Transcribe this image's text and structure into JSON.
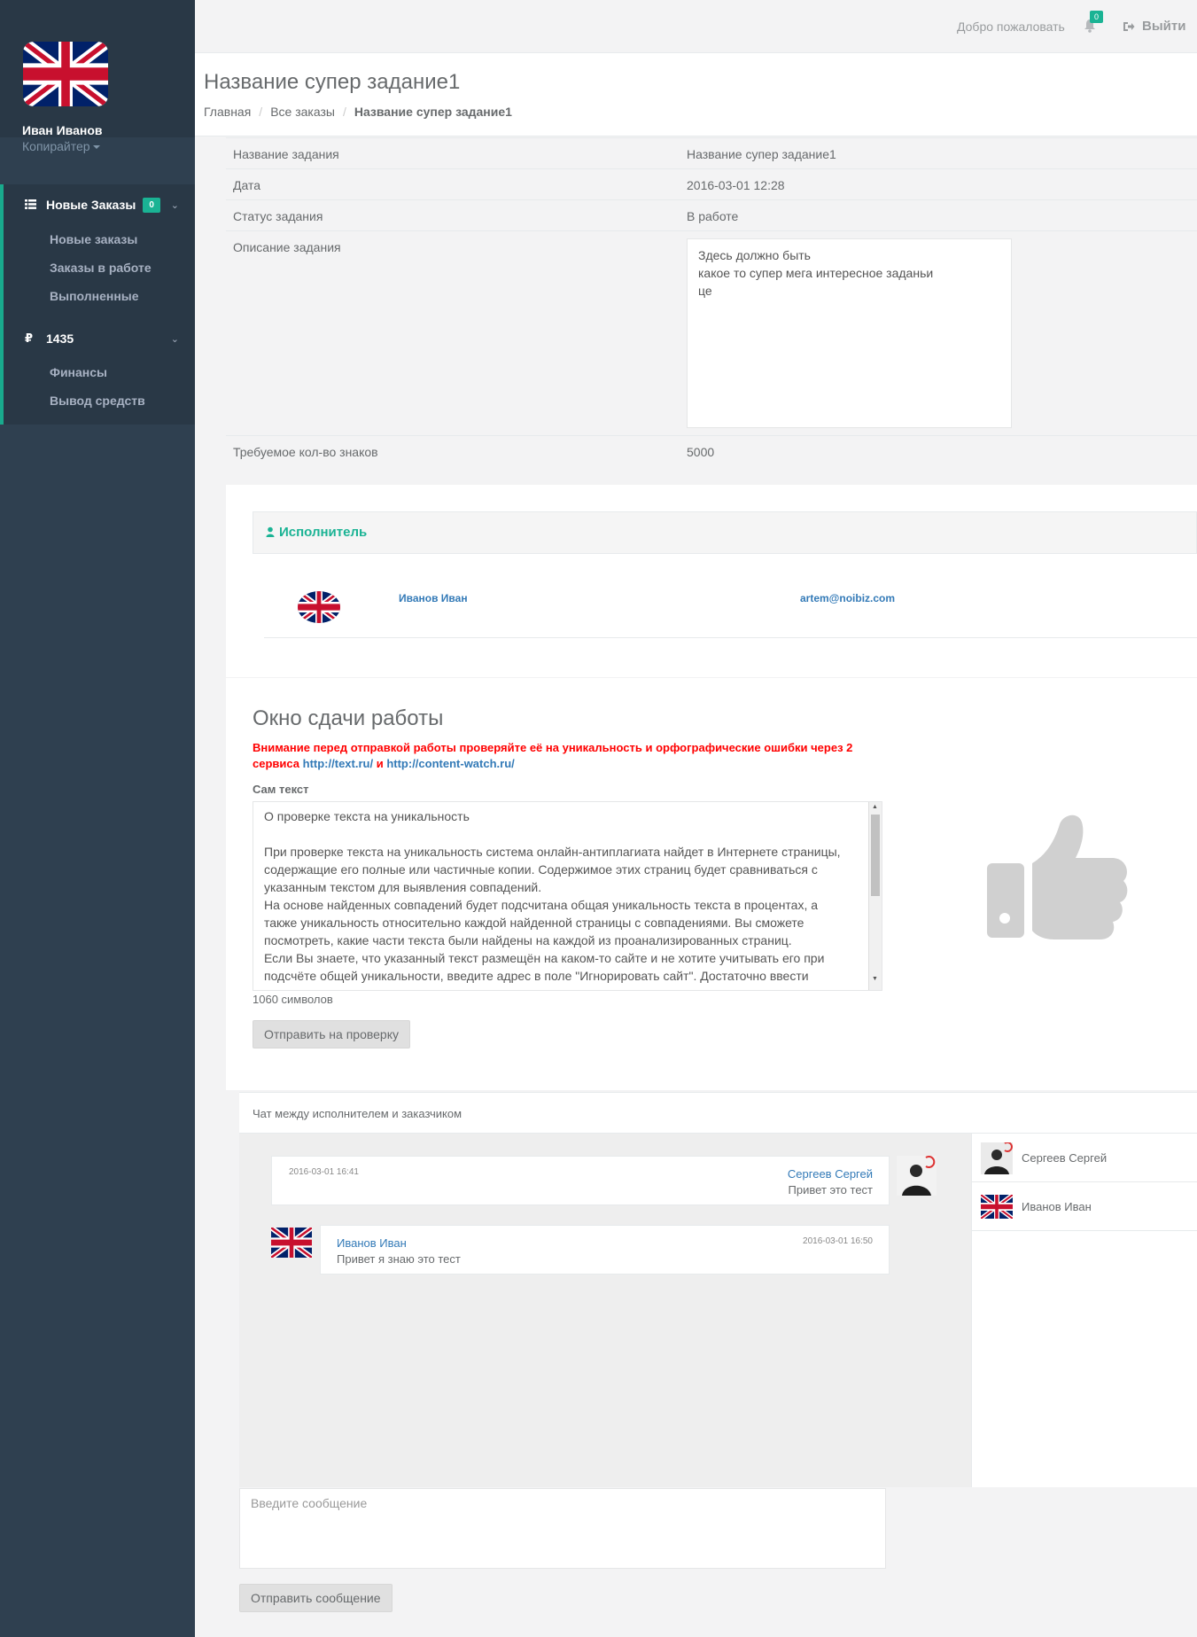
{
  "sidebar": {
    "user_name": "Иван Иванов",
    "user_role": "Копирайтер",
    "group1": {
      "label": "Новые Заказы",
      "badge": "0",
      "items": [
        "Новые заказы",
        "Заказы в работе",
        "Выполненные"
      ]
    },
    "group2": {
      "label": "1435",
      "icon": "₽",
      "items": [
        "Финансы",
        "Вывод средств"
      ]
    }
  },
  "topbar": {
    "welcome": "Добро пожаловать",
    "notifications": "0",
    "logout": "Выйти"
  },
  "page": {
    "title": "Название супер задание1",
    "breadcrumb": [
      "Главная",
      "Все заказы",
      "Название супер задание1"
    ]
  },
  "details": [
    {
      "key": "Название задания",
      "value": "Название супер задание1"
    },
    {
      "key": "Дата",
      "value": "2016-03-01 12:28"
    },
    {
      "key": "Статус задания",
      "value": "В работе"
    },
    {
      "key": "Описание задания",
      "value": "Здесь должно быть\nкакое то супер мега интересное заданьи\nце"
    },
    {
      "key": "Требуемое кол-во знаков",
      "value": "5000"
    }
  ],
  "executor": {
    "heading": "Исполнитель",
    "name": "Иванов Иван",
    "email": "artem@noibiz.com"
  },
  "submit": {
    "title": "Окно сдачи работы",
    "warning": "Внимание перед отправкой работы проверяйте её на уникальность и орфографические ошибки через 2 сервиса",
    "link1": "http://text.ru/",
    "and": "и",
    "link2": "http://content-watch.ru/",
    "text_label": "Сам текст",
    "text_value": "О проверке текста на уникальность\n\nПри проверке текста на уникальность система онлайн-антиплагиата найдет в Интернете страницы, содержащие его полные или частичные копии. Содержимое этих страниц будет сравниваться с указанным текстом для выявления совпадений.\nНа основе найденных совпадений будет подсчитана общая уникальность текста в процентах, а также уникальность относительно каждой найденной страницы с совпадениями. Вы сможете посмотреть, какие части текста были найдены на каждой из проанализированных страниц.\nЕсли Вы знаете, что указанный текст размещён на каком-то сайте и не хотите учитывать его при подсчёте общей уникальности, введите адрес в поле \"Игнорировать сайт\". Достаточно ввести",
    "counter": "1060 символов",
    "button": "Отправить на проверку"
  },
  "chat": {
    "heading": "Чат между исполнителем и заказчиком",
    "messages": [
      {
        "time": "2016-03-01 16:41",
        "author": "Сергеев Сергей",
        "text": "Привет это тест"
      },
      {
        "time": "2016-03-01 16:50",
        "author": "Иванов Иван",
        "text": "Привет я знаю это тест"
      }
    ],
    "users": [
      "Сергеев Сергей",
      "Иванов Иван"
    ],
    "input_placeholder": "Введите сообщение",
    "send_button": "Отправить сообщение"
  },
  "colors": {
    "sidebar": "#2f4050",
    "accent": "#1ab394",
    "link": "#337ab7",
    "warning": "#ff0000"
  }
}
